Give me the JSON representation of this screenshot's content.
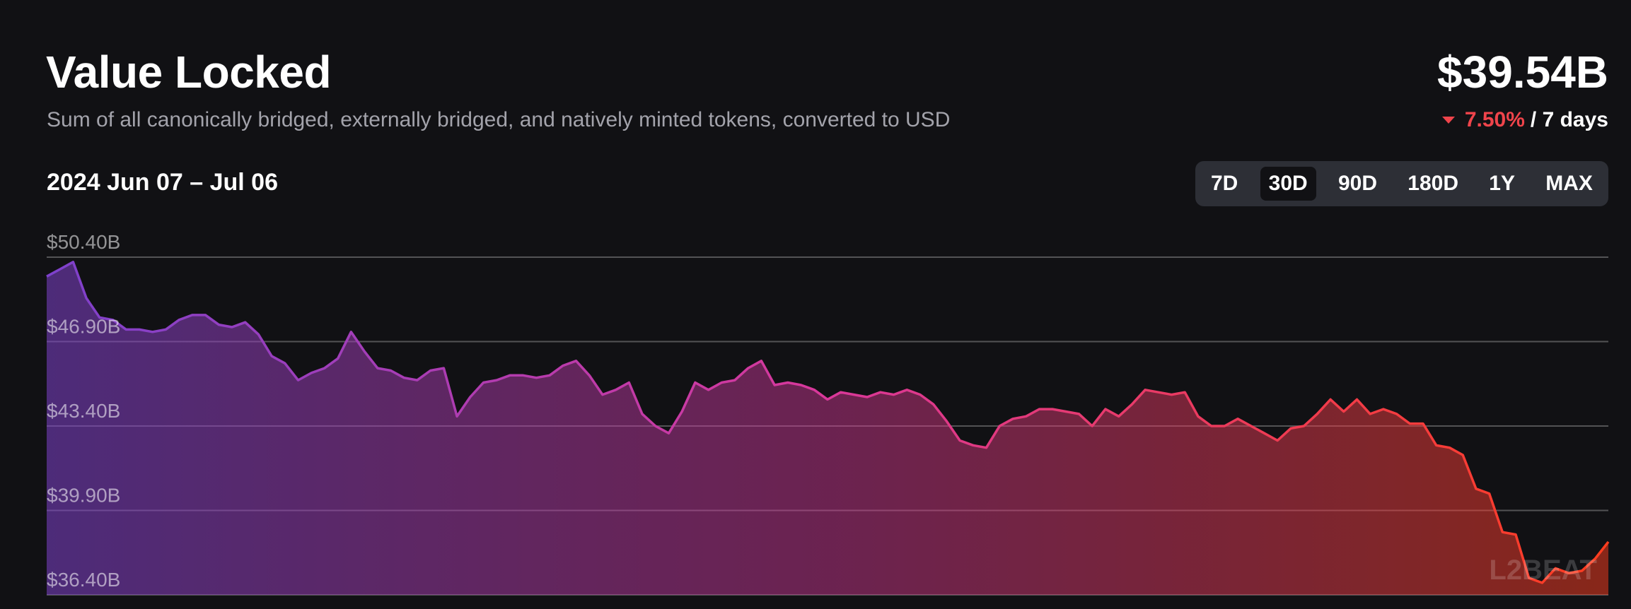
{
  "header": {
    "title": "Value Locked",
    "subtitle": "Sum of all canonically bridged, externally bridged, and natively minted tokens, converted to USD",
    "total_value": "$39.54B",
    "change_value": "7.50%",
    "change_period": "/ 7 days",
    "change_direction": "down",
    "date_range": "2024 Jun 07 – Jul 06"
  },
  "tabs": [
    {
      "label": "7D",
      "active": false
    },
    {
      "label": "30D",
      "active": true
    },
    {
      "label": "90D",
      "active": false
    },
    {
      "label": "180D",
      "active": false
    },
    {
      "label": "1Y",
      "active": false
    },
    {
      "label": "MAX",
      "active": false
    }
  ],
  "colors": {
    "background": "#111114",
    "negative": "#f0444b",
    "gradient_start": "#7e41cc",
    "gradient_mid": "#d9389a",
    "gradient_end": "#ff3d1e"
  },
  "watermark": "L2BEAT",
  "chart_data": {
    "type": "area",
    "y_tick_labels": [
      "$50.40B",
      "$46.90B",
      "$43.40B",
      "$39.90B",
      "$36.40B"
    ],
    "y_ticks": [
      50.4,
      46.9,
      43.4,
      39.9,
      36.4
    ],
    "ylim": [
      36.4,
      50.4
    ],
    "grid": true,
    "x_range": [
      "2024-06-07",
      "2024-07-06"
    ],
    "sampling": "6-hourly",
    "y": [
      49.6,
      49.9,
      50.2,
      48.7,
      47.9,
      47.8,
      47.4,
      47.4,
      47.3,
      47.4,
      47.8,
      48.0,
      48.0,
      47.6,
      47.5,
      47.7,
      47.2,
      46.3,
      46.0,
      45.3,
      45.6,
      45.8,
      46.2,
      47.3,
      46.5,
      45.8,
      45.7,
      45.4,
      45.3,
      45.7,
      45.8,
      43.8,
      44.6,
      45.2,
      45.3,
      45.5,
      45.5,
      45.4,
      45.5,
      45.9,
      46.1,
      45.5,
      44.7,
      44.9,
      45.2,
      43.9,
      43.4,
      43.1,
      44.0,
      45.2,
      44.9,
      45.2,
      45.3,
      45.8,
      46.1,
      45.1,
      45.2,
      45.1,
      44.9,
      44.5,
      44.8,
      44.7,
      44.6,
      44.8,
      44.7,
      44.9,
      44.7,
      44.3,
      43.6,
      42.8,
      42.6,
      42.5,
      43.4,
      43.7,
      43.8,
      44.1,
      44.1,
      44.0,
      43.9,
      43.4,
      44.1,
      43.8,
      44.3,
      44.9,
      44.8,
      44.7,
      44.8,
      43.8,
      43.4,
      43.4,
      43.7,
      43.4,
      43.1,
      42.8,
      43.3,
      43.4,
      43.9,
      44.5,
      44.0,
      44.5,
      43.9,
      44.1,
      43.9,
      43.5,
      43.5,
      42.6,
      42.5,
      42.2,
      40.8,
      40.6,
      39.0,
      38.9,
      37.1,
      36.9,
      37.5,
      37.3,
      37.4,
      37.9,
      38.6
    ]
  }
}
